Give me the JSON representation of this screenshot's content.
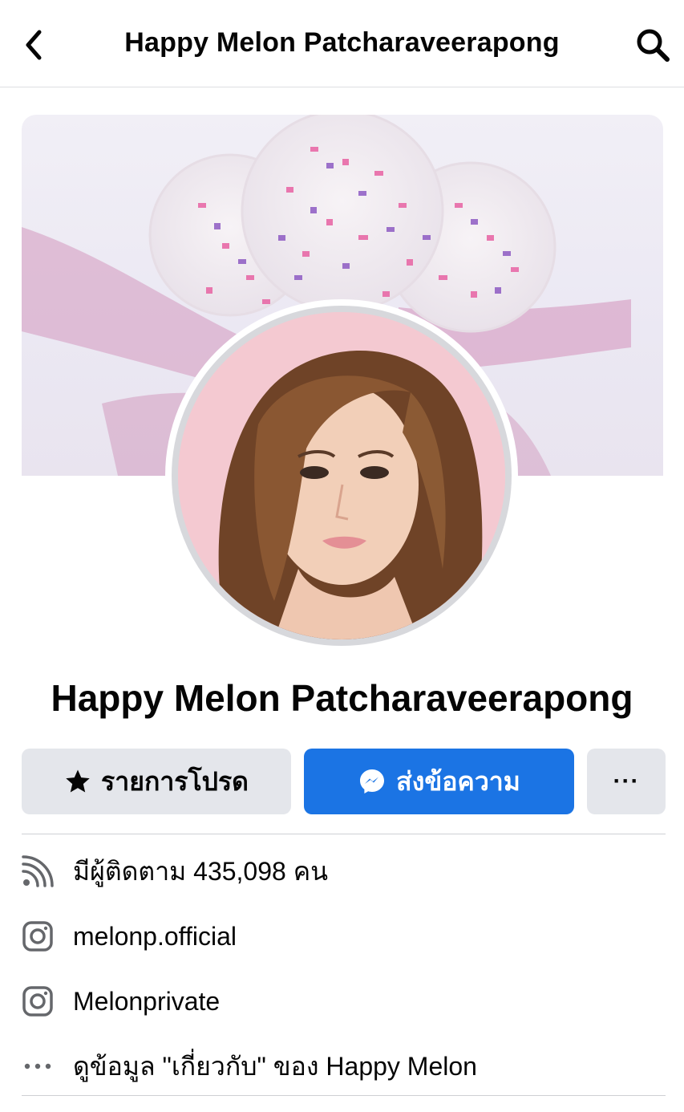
{
  "header": {
    "title": "Happy Melon Patcharaveerapong"
  },
  "profile": {
    "name": "Happy Melon Patcharaveerapong"
  },
  "actions": {
    "favorite_label": "รายการโปรด",
    "message_label": "ส่งข้อความ",
    "more_label": "···"
  },
  "info": {
    "followers": "มีผู้ติดตาม 435,098 คน",
    "instagram_1": "melonp.official",
    "instagram_2": "Melonprivate",
    "about": "ดูข้อมูล \"เกี่ยวกับ\" ของ Happy Melon"
  },
  "colors": {
    "accent": "#1b74e4",
    "button_gray": "#e4e6eb",
    "icon_gray": "#65676b"
  },
  "icons": {
    "back": "chevron-left-icon",
    "search": "search-icon",
    "favorite": "star-icon",
    "message": "messenger-icon",
    "followers": "rss-feed-icon",
    "instagram": "instagram-icon",
    "about": "more-dots-icon"
  }
}
